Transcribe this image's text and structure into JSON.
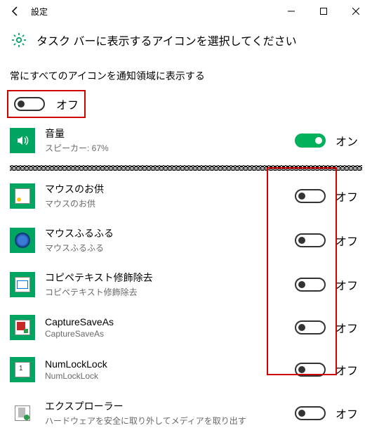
{
  "window": {
    "title": "設定"
  },
  "header": {
    "page_title": "タスク バーに表示するアイコンを選択してください"
  },
  "always_show": {
    "label": "常にすべてのアイコンを通知領域に表示する",
    "state": "オフ"
  },
  "items": [
    {
      "name": "音量",
      "desc": "スピーカー: 67%",
      "state": "オン",
      "on": true,
      "icon": "volume"
    },
    {
      "name": "マウスのお供",
      "desc": "マウスのお供",
      "state": "オフ",
      "on": false,
      "icon": "mouse"
    },
    {
      "name": "マウスふるふる",
      "desc": "マウスふるふる",
      "state": "オフ",
      "on": false,
      "icon": "globe"
    },
    {
      "name": "コピペテキスト修飾除去",
      "desc": "コピペテキスト修飾除去",
      "state": "オフ",
      "on": false,
      "icon": "copy"
    },
    {
      "name": "CaptureSaveAs",
      "desc": "CaptureSaveAs",
      "state": "オフ",
      "on": false,
      "icon": "capture"
    },
    {
      "name": "NumLockLock",
      "desc": "NumLockLock",
      "state": "オフ",
      "on": false,
      "icon": "num"
    },
    {
      "name": "エクスプローラー",
      "desc": "ハードウェアを安全に取り外してメディアを取り出す",
      "state": "オフ",
      "on": false,
      "icon": "explorer"
    }
  ]
}
